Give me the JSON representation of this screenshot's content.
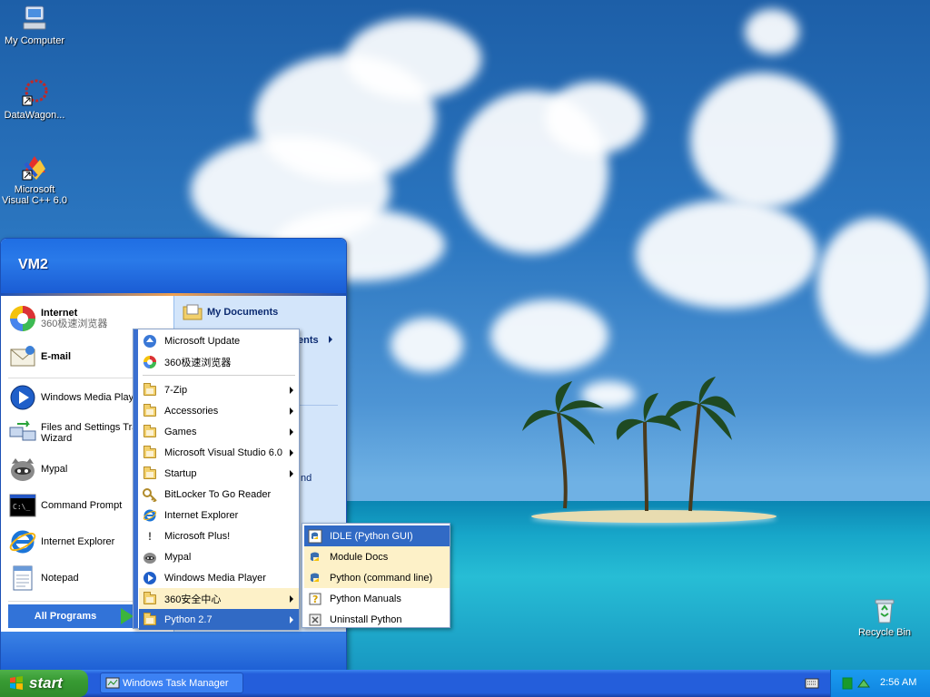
{
  "desktop": {
    "icons": [
      {
        "label": "My Computer",
        "icon": "computer-icon"
      },
      {
        "label": "DataWagon...",
        "icon": "datawagon-icon"
      },
      {
        "label": "Microsoft Visual C++ 6.0",
        "icon": "visual-cpp-icon"
      },
      {
        "label": "Recycle Bin",
        "icon": "recycle-bin-icon"
      }
    ]
  },
  "start_menu": {
    "user": "VM2",
    "pinned": [
      {
        "label": "Internet",
        "sub": "360极速浏览器",
        "icon": "browser-360-icon"
      },
      {
        "label": "E-mail",
        "icon": "email-icon"
      }
    ],
    "recent": [
      {
        "label": "Windows Media Player",
        "icon": "media-player-icon"
      },
      {
        "label": "Files and Settings Transfer Wizard",
        "icon": "transfer-wizard-icon"
      },
      {
        "label": "Mypal",
        "icon": "mypal-icon"
      },
      {
        "label": "Command Prompt",
        "icon": "command-prompt-icon"
      },
      {
        "label": "Internet Explorer",
        "icon": "internet-explorer-icon"
      },
      {
        "label": "Notepad",
        "icon": "notepad-icon"
      }
    ],
    "all_programs": "All Programs",
    "right": {
      "my_documents": "My Documents",
      "partial_1": "ents",
      "partial_2": "nd"
    }
  },
  "programs_menu": {
    "items": [
      {
        "label": "Microsoft Update",
        "icon": "microsoft-update-icon",
        "submenu": false
      },
      {
        "label": "360极速浏览器",
        "icon": "browser-360-icon",
        "submenu": false
      },
      {
        "label": "7-Zip",
        "icon": "folder-icon",
        "submenu": true
      },
      {
        "label": "Accessories",
        "icon": "folder-icon",
        "submenu": true
      },
      {
        "label": "Games",
        "icon": "folder-icon",
        "submenu": true
      },
      {
        "label": "Microsoft Visual Studio 6.0",
        "icon": "folder-icon",
        "submenu": true
      },
      {
        "label": "Startup",
        "icon": "folder-icon",
        "submenu": true
      },
      {
        "label": "BitLocker To Go Reader",
        "icon": "bitlocker-icon",
        "submenu": false
      },
      {
        "label": "Internet Explorer",
        "icon": "internet-explorer-icon",
        "submenu": false
      },
      {
        "label": "Microsoft Plus!",
        "icon": "microsoft-plus-icon",
        "submenu": false
      },
      {
        "label": "Mypal",
        "icon": "mypal-icon",
        "submenu": false
      },
      {
        "label": "Windows Media Player",
        "icon": "media-player-icon",
        "submenu": false
      },
      {
        "label": "360安全中心",
        "icon": "folder-icon",
        "submenu": true
      },
      {
        "label": "Python 2.7",
        "icon": "folder-icon",
        "submenu": true
      }
    ]
  },
  "python_menu": {
    "items": [
      {
        "label": "IDLE (Python GUI)",
        "icon": "idle-icon"
      },
      {
        "label": "Module Docs",
        "icon": "module-docs-icon"
      },
      {
        "label": "Python (command line)",
        "icon": "python-icon"
      },
      {
        "label": "Python Manuals",
        "icon": "python-manuals-icon"
      },
      {
        "label": "Uninstall Python",
        "icon": "uninstall-icon"
      }
    ]
  },
  "taskbar": {
    "start_label": "start",
    "tasks": [
      {
        "label": "Windows Task Manager",
        "icon": "task-manager-icon"
      }
    ],
    "clock": "2:56 AM"
  },
  "colors": {
    "taskbar_blue": "#245edb",
    "start_green": "#389b33",
    "selection_blue": "#316ac5",
    "hover_yellow": "#fdf1c8"
  }
}
